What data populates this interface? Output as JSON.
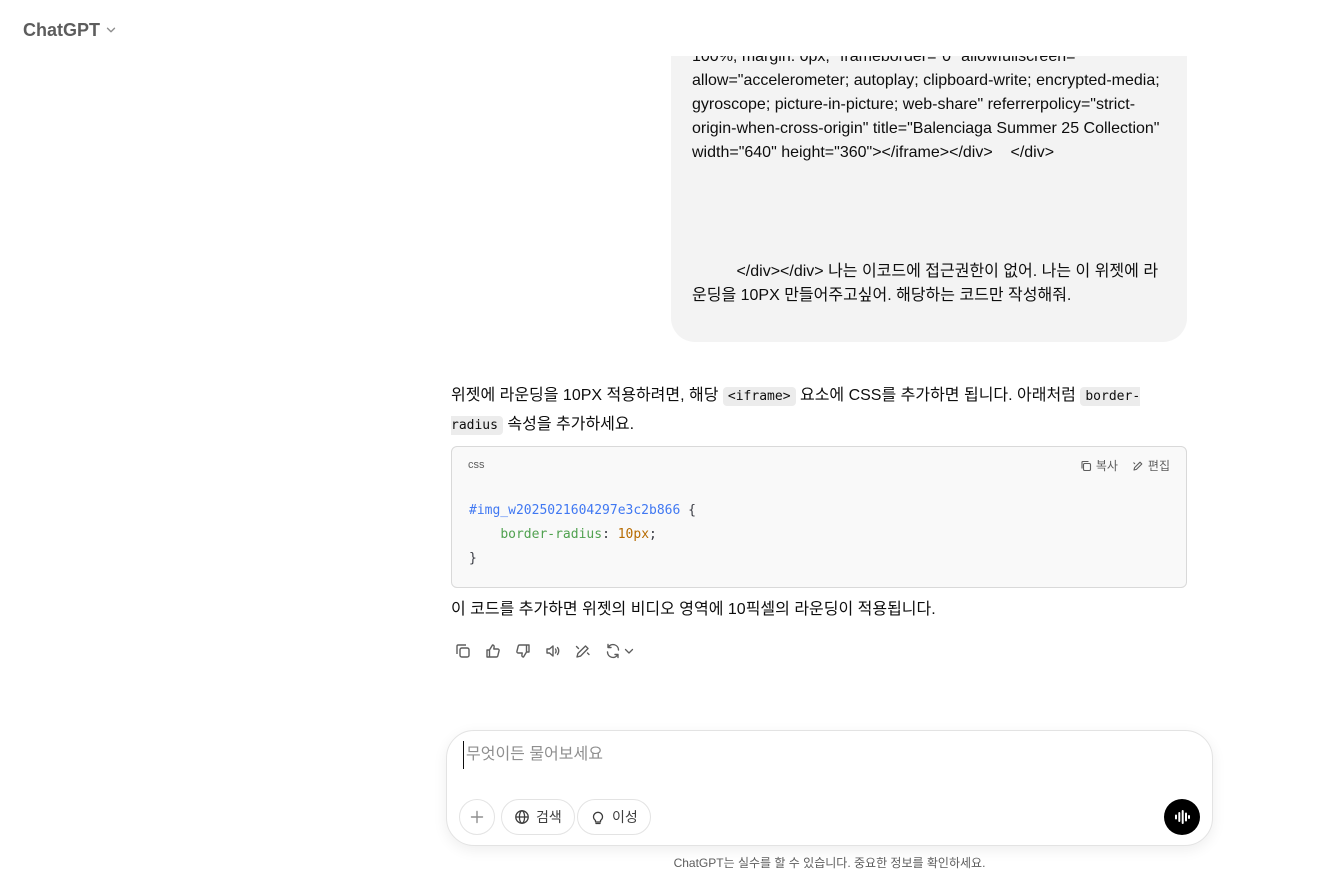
{
  "header": {
    "model_name": "ChatGPT"
  },
  "user_message": {
    "fragment_top": "100%; margin: 0px;\" frameborder=\"0\" allowfullscreen=\"\" allow=\"accelerometer; autoplay; clipboard-write; encrypted-media; gyroscope; picture-in-picture; web-share\" referrerpolicy=\"strict-origin-when-cross-origin\" title=\"Balenciaga Summer 25 Collection\" width=\"640\" height=\"360\"></iframe></div>    </div>",
    "fragment_bottom": "          </div></div> 나는 이코드에 접근권한이 없어. 나는 이 위젯에 라운딩을 10PX 만들어주고싶어. 해당하는 코드만 작성해줘."
  },
  "assistant": {
    "intro_part1": "위젯에 라운딩을 10PX 적용하려면, 해당 ",
    "intro_code1": "<iframe>",
    "intro_part2": " 요소에 CSS를 추가하면 됩니다. 아래처럼 ",
    "intro_code2": "border-radius",
    "intro_part3": " 속성을 추가하세요.",
    "code_lang": "css",
    "copy_label": "복사",
    "edit_label": "편집",
    "code_selector": "#img_w2025021604297e3c2b866",
    "code_open": " {",
    "code_indent": "    ",
    "code_property": "border-radius",
    "code_colon": ": ",
    "code_value": "10px",
    "code_semicolon": ";",
    "code_close": "}",
    "outro": "이 코드를 추가하면 위젯의 비디오 영역에 10픽셀의 라운딩이 적용됩니다."
  },
  "message_actions": [
    "copy-icon",
    "thumbs-up-icon",
    "thumbs-down-icon",
    "read-aloud-icon",
    "edit-icon",
    "regenerate-icon"
  ],
  "composer": {
    "placeholder": "무엇이든 물어보세요",
    "search_label": "검색",
    "reason_label": "이성"
  },
  "footer": {
    "disclaimer": "ChatGPT는 실수를 할 수 있습니다. 중요한 정보를 확인하세요."
  }
}
